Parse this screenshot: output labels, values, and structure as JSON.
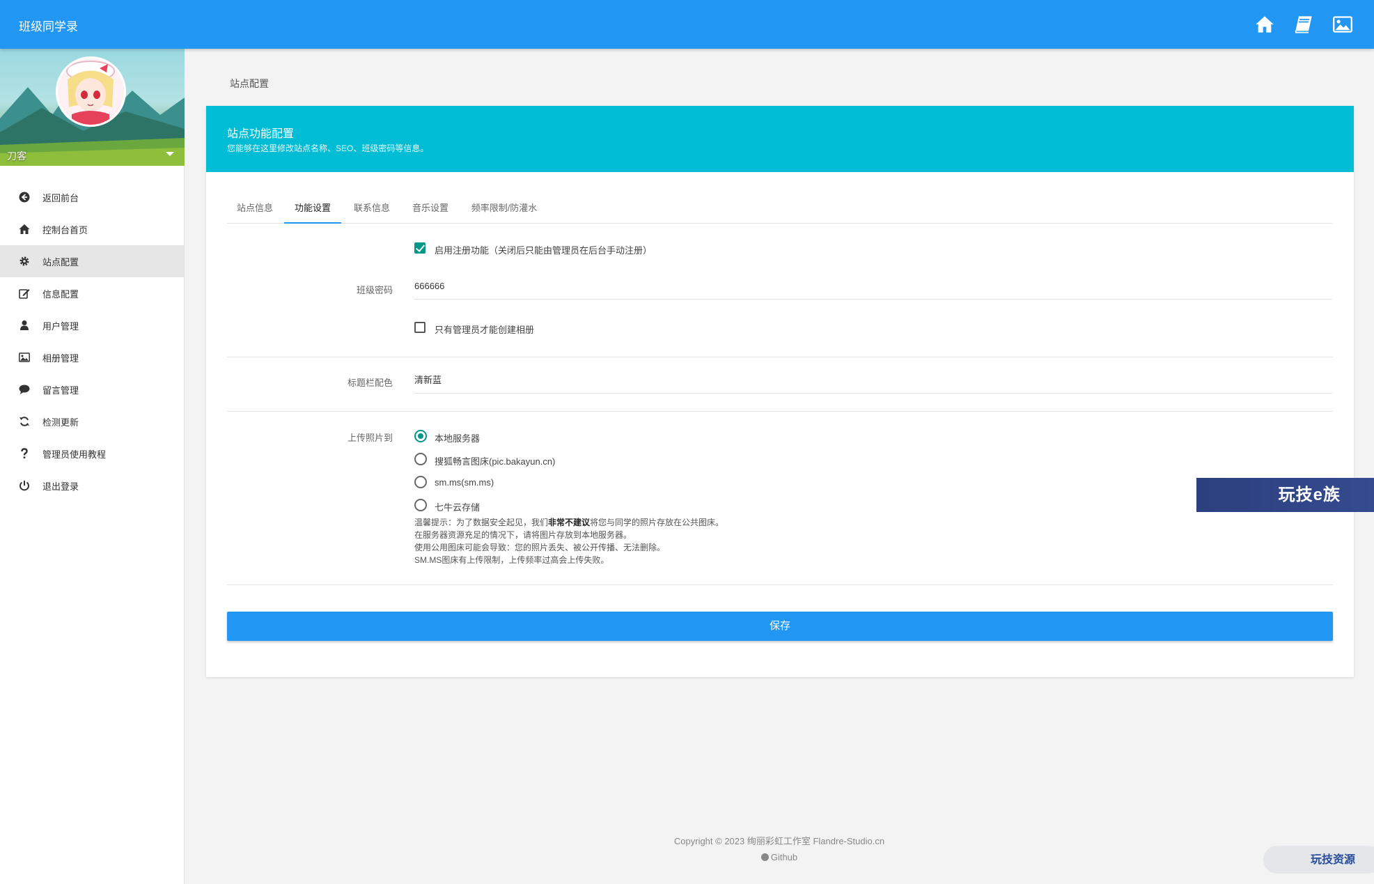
{
  "header": {
    "app_title": "班级同学录",
    "icons": [
      "home-icon",
      "book-icon",
      "image-icon"
    ],
    "color": "#2196f3"
  },
  "sidebar": {
    "username": "刀客",
    "items": [
      {
        "label": "返回前台",
        "icon": "arrow-left-circle-icon"
      },
      {
        "label": "控制台首页",
        "icon": "home-icon"
      },
      {
        "label": "站点配置",
        "icon": "gear-icon",
        "active": true
      },
      {
        "label": "信息配置",
        "icon": "edit-icon"
      },
      {
        "label": "用户管理",
        "icon": "user-icon"
      },
      {
        "label": "相册管理",
        "icon": "image-icon"
      },
      {
        "label": "留言管理",
        "icon": "comment-icon"
      },
      {
        "label": "检测更新",
        "icon": "refresh-icon"
      },
      {
        "label": "管理员使用教程",
        "icon": "question-icon"
      },
      {
        "label": "退出登录",
        "icon": "power-icon"
      }
    ]
  },
  "breadcrumb": "站点配置",
  "card": {
    "title": "站点功能配置",
    "subtitle": "您能够在这里修改站点名称、SEO、班级密码等信息。",
    "header_color": "#00bcd4"
  },
  "tabs": [
    {
      "label": "站点信息"
    },
    {
      "label": "功能设置",
      "active": true
    },
    {
      "label": "联系信息"
    },
    {
      "label": "音乐设置"
    },
    {
      "label": "频率限制/防灌水"
    }
  ],
  "form": {
    "register_checkbox_label": "启用注册功能（关闭后只能由管理员在后台手动注册）",
    "register_enabled": true,
    "class_password_label": "班级密码",
    "class_password_value": "666666",
    "admin_album_label": "只有管理员才能创建相册",
    "admin_album_checked": false,
    "titlebar_color_label": "标题栏配色",
    "titlebar_color_value": "清新蓝",
    "upload_label": "上传照片到",
    "upload_options": [
      {
        "label": "本地服务器",
        "selected": true
      },
      {
        "label": "搜狐畅言图床(pic.bakayun.cn)"
      },
      {
        "label": "sm.ms(sm.ms)"
      },
      {
        "label": "七牛云存储"
      }
    ],
    "hint": {
      "line1_a": "温馨提示：为了数据安全起见，我们",
      "line1_b": "非常不建议",
      "line1_c": "将您与同学的照片存放在公共图床。",
      "line2": "在服务器资源充足的情况下，请将图片存放到本地服务器。",
      "line3": "使用公用图床可能会导致：您的照片丢失、被公开传播、无法删除。",
      "line4": "SM.MS图床有上传限制，上传频率过高会上传失败。"
    },
    "save_label": "保存"
  },
  "watermark": "玩技e族",
  "corner_badge": "玩技资源",
  "footer": {
    "copyright": "Copyright © 2023 绚丽彩虹工作室 Flandre-Studio.cn",
    "github": "Github"
  }
}
